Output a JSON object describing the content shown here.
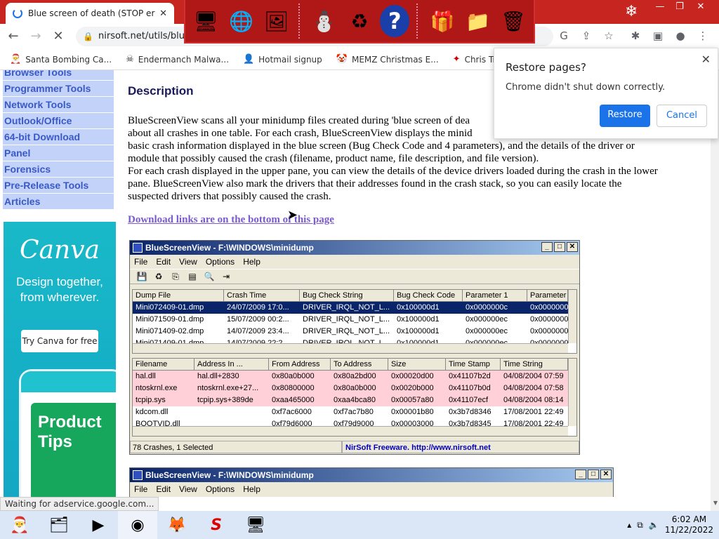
{
  "browser": {
    "tab_title": "Blue screen of death (STOP error",
    "tab_close": "✕",
    "new_tab": "+",
    "url": "nirsoft.net/utils/blue",
    "window_controls": [
      "—",
      "❐",
      "✕"
    ]
  },
  "xmas_toolbar": {
    "icons": [
      "santa-computer-icon",
      "globe-icon",
      "mail-card-icon",
      "snowman-icon",
      "recycle-icon",
      "help-icon",
      "gift-icon",
      "folder-icon",
      "trash-icon"
    ]
  },
  "bookmarks": [
    {
      "label": "Santa Bombing Ca...",
      "icon": "santa-icon"
    },
    {
      "label": "Endermanch Malwa...",
      "icon": "skull-icon"
    },
    {
      "label": "Hotmail signup",
      "icon": "user-icon"
    },
    {
      "label": "MEMZ Christmas E...",
      "icon": "clown-icon"
    },
    {
      "label": "Chris Tracker",
      "icon": "card-icon"
    }
  ],
  "leftnav": [
    "Browser Tools",
    "Programmer Tools",
    "Network Tools",
    "Outlook/Office",
    "64-bit Download",
    "Panel",
    "Forensics",
    "Pre-Release Tools",
    "Articles"
  ],
  "ad": {
    "logo": "Canva",
    "tagline": "Design together, from wherever.",
    "cta": "Try Canva for free",
    "card_text": "Product Tips"
  },
  "content": {
    "heading": "Description",
    "para1_lines": [
      "BlueScreenView scans all your minidump files created during 'blue screen of dea",
      "about all crashes in one table. For each crash, BlueScreenView displays the minid",
      "basic crash information displayed in the blue screen (Bug Check Code and 4 parameters), and the details of the driver or",
      "module that possibly caused the crash (filename, product name, file description, and file version)."
    ],
    "para2_lines": [
      "For each crash displayed in the upper pane, you can view the details of the device drivers loaded during the crash in the lower",
      "pane. BlueScreenView also mark the drivers that their addresses found in the crash stack, so you can easily locate the",
      "suspected drivers that possibly caused the crash."
    ],
    "download_link": "Download links are on the bottom of this page"
  },
  "restore_popup": {
    "title": "Restore pages?",
    "subtitle": "Chrome didn't shut down correctly.",
    "restore": "Restore",
    "cancel": "Cancel",
    "close": "✕"
  },
  "bsv_window": {
    "title": "BlueScreenView  -  F:\\WINDOWS\\minidump",
    "menu": [
      "File",
      "Edit",
      "View",
      "Options",
      "Help"
    ],
    "upper_columns": [
      "Dump File",
      "Crash Time",
      "Bug Check String",
      "Bug Check Code",
      "Parameter 1",
      "Parameter"
    ],
    "upper_rows": [
      [
        "Mini072409-01.dmp",
        "24/07/2009 17:0...",
        "DRIVER_IRQL_NOT_L...",
        "0x100000d1",
        "0x0000000c",
        "0x0000000"
      ],
      [
        "Mini071509-01.dmp",
        "15/07/2009 00:2...",
        "DRIVER_IRQL_NOT_L...",
        "0x100000d1",
        "0x000000ec",
        "0x0000000"
      ],
      [
        "Mini071409-02.dmp",
        "14/07/2009 23:4...",
        "DRIVER_IRQL_NOT_L...",
        "0x100000d1",
        "0x000000ec",
        "0x0000000"
      ],
      [
        "Mini071409-01.dmp",
        "14/07/2009 22:2...",
        "DRIVER_IRQL_NOT_L...",
        "0x100000d1",
        "0x000000ec",
        "0x0000000"
      ]
    ],
    "lower_columns": [
      "Filename",
      "Address In ...",
      "From Address",
      "To Address",
      "Size",
      "Time Stamp",
      "Time String"
    ],
    "lower_rows": [
      [
        "hal.dll",
        "hal.dll+2830",
        "0x80a0b000",
        "0x80a2bd00",
        "0x00020d00",
        "0x41107b2d",
        "04/08/2004 07:59"
      ],
      [
        "ntoskrnl.exe",
        "ntoskrnl.exe+27...",
        "0x80800000",
        "0x80a0b000",
        "0x0020b000",
        "0x41107b0d",
        "04/08/2004 07:58"
      ],
      [
        "tcpip.sys",
        "tcpip.sys+389de",
        "0xaa465000",
        "0xaa4bca80",
        "0x00057a80",
        "0x41107ecf",
        "04/08/2004 08:14"
      ],
      [
        "kdcom.dll",
        "",
        "0xf7ac6000",
        "0xf7ac7b80",
        "0x00001b80",
        "0x3b7d8346",
        "17/08/2001 22:49"
      ],
      [
        "BOOTVID.dll",
        "",
        "0xf79d6000",
        "0xf79d9000",
        "0x00003000",
        "0x3b7d8345",
        "17/08/2001 22:49"
      ]
    ],
    "status_left": "78 Crashes, 1 Selected",
    "status_right": "NirSoft Freeware.  http://www.nirsoft.net"
  },
  "bsv_window2": {
    "title": "BlueScreenView  -  F:\\WINDOWS\\minidump",
    "menu": [
      "File",
      "Edit",
      "View",
      "Options",
      "Help"
    ]
  },
  "status_bar": "Waiting for adservice.google.com...",
  "taskbar": {
    "apps": [
      "santa-icon",
      "file-explorer-icon",
      "media-player-icon",
      "chrome-icon",
      "firefox-icon",
      "s-app-icon",
      "monitor-app-icon"
    ],
    "time": "6:02 AM",
    "date": "11/22/2022"
  },
  "colors": {
    "tabbar": "#c7251f",
    "nav_bg": "#c3d2f8",
    "nav_text": "#3a59c8",
    "xp_title": "#0a246a",
    "chrome_blue": "#1a73e8"
  }
}
